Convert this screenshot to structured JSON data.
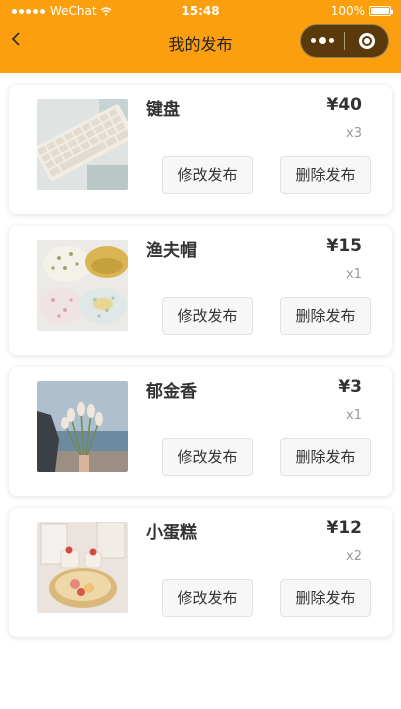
{
  "status_bar": {
    "carrier": "WeChat",
    "time": "15:48",
    "battery": "100%"
  },
  "nav": {
    "title": "我的发布",
    "back_icon": "chevron-left-icon",
    "capsule_more_icon": "more-dots-icon",
    "capsule_close_icon": "target-circle-icon"
  },
  "colors": {
    "nav_bg": "#fb9f0e",
    "card_bg": "#ffffff",
    "text_primary": "#333333",
    "text_muted": "#999999"
  },
  "products": [
    {
      "name": "键盘",
      "price": "¥40",
      "qty": "x3",
      "image": "keyboard-photo",
      "edit_label": "修改发布",
      "delete_label": "删除发布"
    },
    {
      "name": "渔夫帽",
      "price": "¥15",
      "qty": "x1",
      "image": "bucket-hats-photo",
      "edit_label": "修改发布",
      "delete_label": "删除发布"
    },
    {
      "name": "郁金香",
      "price": "¥3",
      "qty": "x1",
      "image": "tulips-by-sea-photo",
      "edit_label": "修改发布",
      "delete_label": "删除发布"
    },
    {
      "name": "小蛋糕",
      "price": "¥12",
      "qty": "x2",
      "image": "small-cakes-photo",
      "edit_label": "修改发布",
      "delete_label": "删除发布"
    }
  ]
}
